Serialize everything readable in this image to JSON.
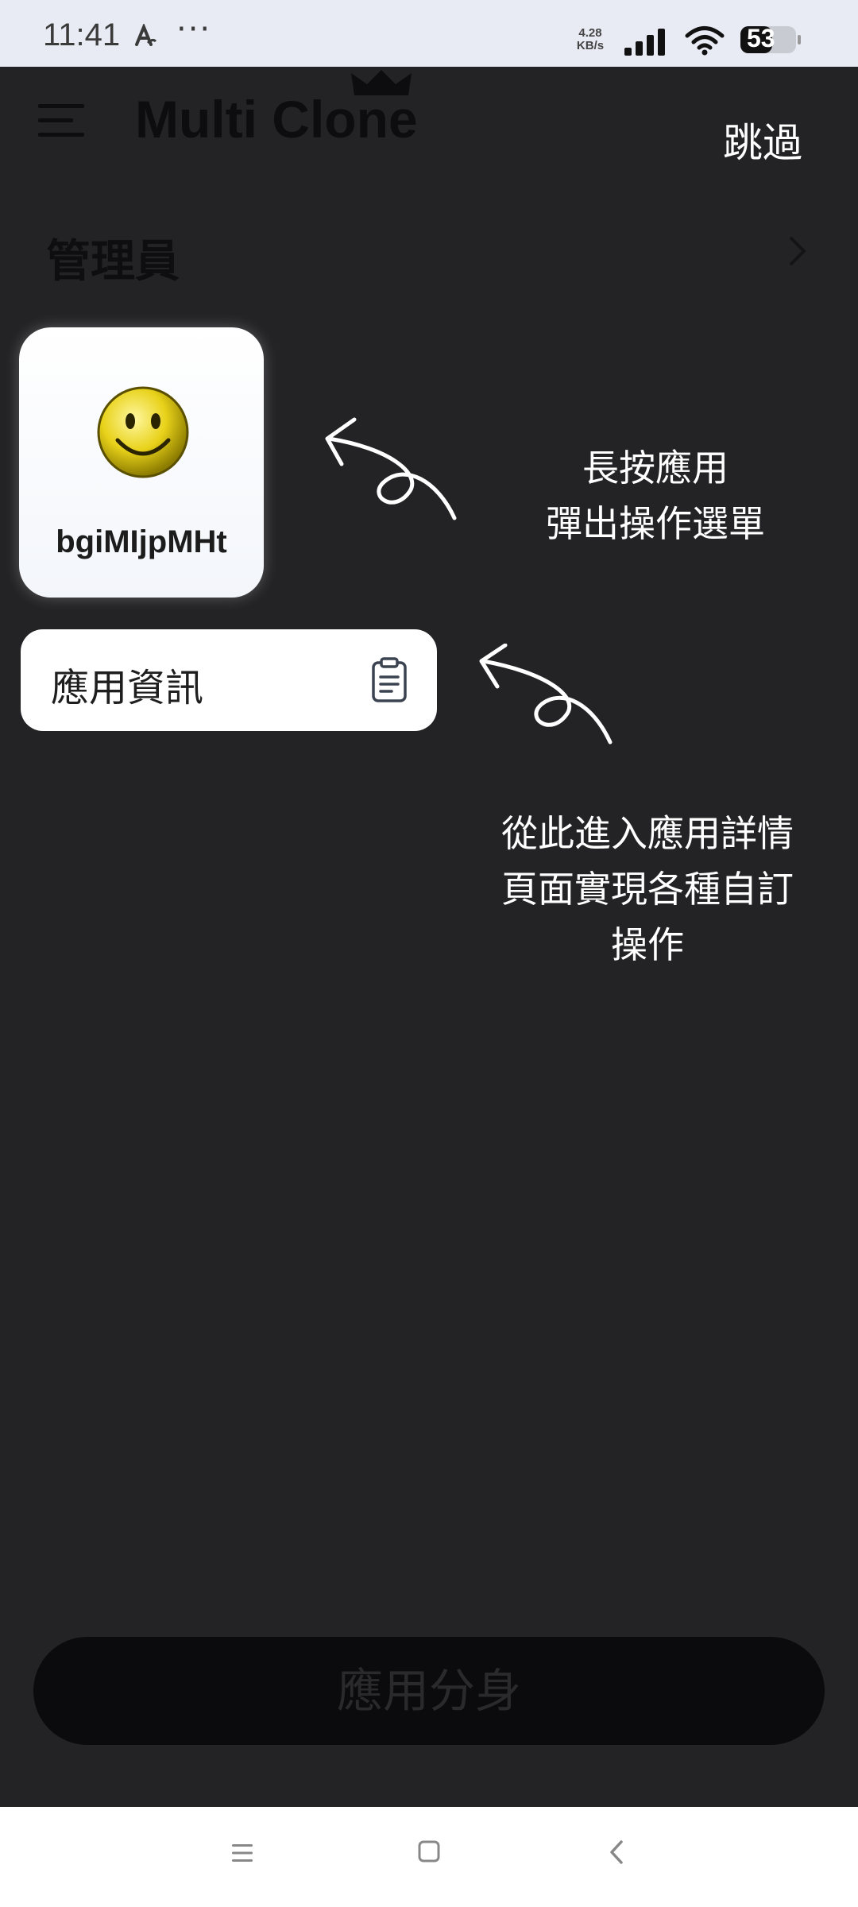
{
  "status_bar": {
    "time": "11:41",
    "more": "···",
    "net_speed_value": "4.28",
    "net_speed_unit": "KB/s",
    "battery": "53"
  },
  "header": {
    "app_title": "Multi Clone",
    "skip_label": "跳過"
  },
  "section": {
    "title": "管理員"
  },
  "app_card": {
    "name": "bgiMIjpMHt"
  },
  "popup_menu": {
    "info_label": "應用資訊"
  },
  "hints": {
    "long_press_line1": "長按應用",
    "long_press_line2": "彈出操作選單",
    "details_line1": "從此進入應用詳情",
    "details_line2": "頁面實現各種自訂",
    "details_line3": "操作"
  },
  "bottom": {
    "clone_button_label": "應用分身"
  },
  "colors": {
    "overlay": "#232325",
    "status_bar_bg": "#e9ebf4",
    "smiley": "#e8d21a"
  }
}
